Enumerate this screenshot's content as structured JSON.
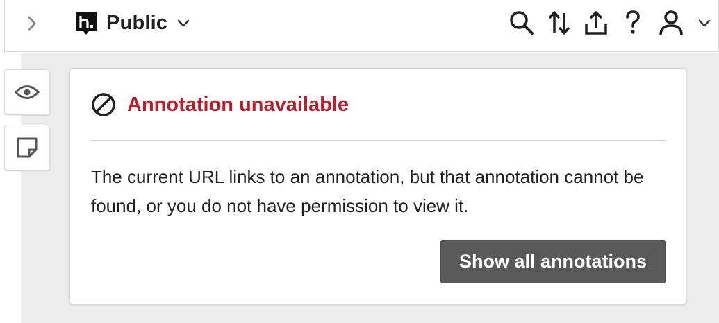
{
  "header": {
    "group_name": "Public",
    "icons": [
      "chevron-right-icon",
      "hypothesis-logo-icon",
      "chevron-down-icon",
      "search-icon",
      "sort-icon",
      "share-icon",
      "help-icon",
      "user-icon",
      "chevron-down-icon"
    ]
  },
  "side_tabs": {
    "icons": [
      "eye-icon",
      "note-icon"
    ]
  },
  "card": {
    "title": "Annotation unavailable",
    "message": "The current URL links to an annotation, but that annotation cannot be found, or you do not have permission to view it.",
    "button_label": "Show all annotations"
  },
  "colors": {
    "title": "#bd1c2b",
    "button_bg": "#595959",
    "content_bg": "#ececec"
  }
}
